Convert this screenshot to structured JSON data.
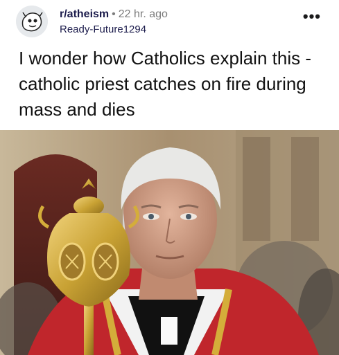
{
  "post": {
    "subreddit": "r/atheism",
    "separator": "•",
    "time": "22 hr. ago",
    "author": "Ready-Future1294",
    "more_icon": "more-options-icon",
    "title": "I wonder how Catholics explain this - catholic priest catches on fire during mass and dies"
  },
  "media": {
    "description_icon": "post-image"
  },
  "colors": {
    "subreddit": "#1c1c4c",
    "meta_gray": "#7c7c7c",
    "vestment_red": "#c0262c",
    "gold": "#c9a234"
  }
}
